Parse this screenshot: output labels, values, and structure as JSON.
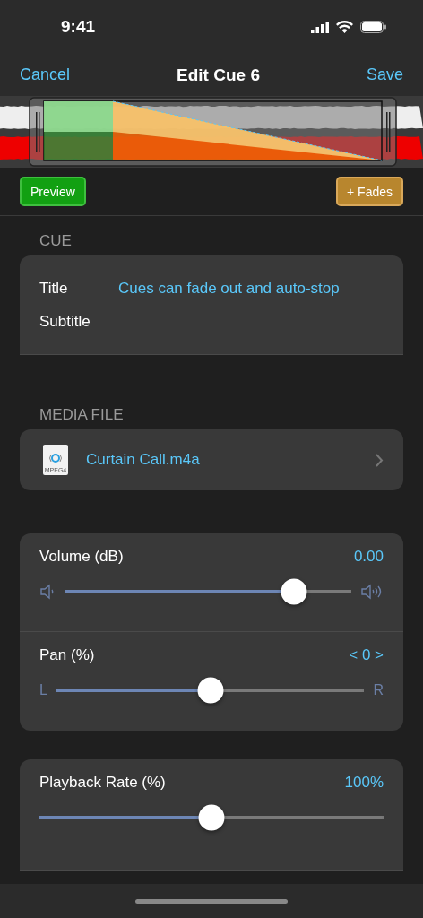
{
  "status_bar": {
    "time": "9:41"
  },
  "nav": {
    "cancel": "Cancel",
    "title": "Edit Cue 6",
    "save": "Save"
  },
  "buttons": {
    "preview": "Preview",
    "fades": "+ Fades"
  },
  "cue_section": {
    "header": "CUE",
    "rows": [
      {
        "label": "Title",
        "value": "Cues can fade out and auto-stop"
      },
      {
        "label": "Subtitle"
      }
    ]
  },
  "media_section": {
    "header": "MEDIA FILE",
    "file": {
      "name": "Curtain Call.m4a",
      "icon_label": "MPEG4"
    }
  },
  "sliders": [
    {
      "kind": "volume",
      "label": "Volume (dB)",
      "reading": "0.00",
      "level": 0.8
    },
    {
      "kind": "pan",
      "label": "Pan (%)",
      "reading": "< 0 >",
      "min_label": "L",
      "max_label": "R",
      "level": 0.5
    }
  ],
  "playback": {
    "label": "Playback Rate (%)",
    "reading": "100%",
    "level": 0.5
  }
}
